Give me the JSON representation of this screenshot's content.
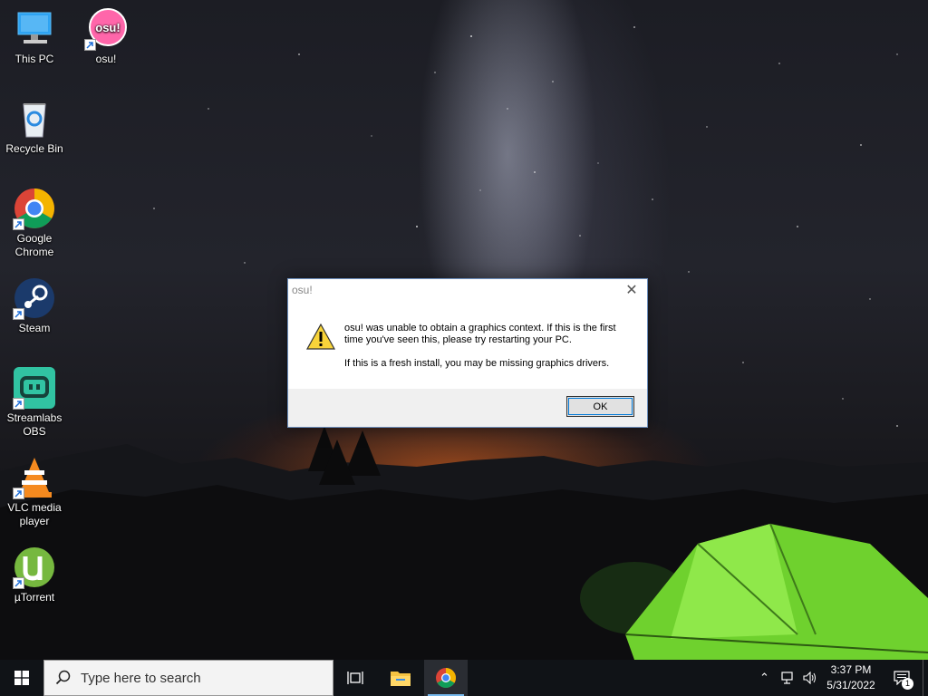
{
  "desktop": {
    "icons": [
      {
        "label": "This PC",
        "icon": "computer-icon"
      },
      {
        "label": "osu!",
        "icon": "osu-icon"
      },
      {
        "label": "Recycle Bin",
        "icon": "recycle-bin-icon"
      },
      {
        "label": "Google Chrome",
        "icon": "chrome-icon"
      },
      {
        "label": "Steam",
        "icon": "steam-icon"
      },
      {
        "label": "Streamlabs OBS",
        "icon": "streamlabs-icon"
      },
      {
        "label": "VLC media player",
        "icon": "vlc-icon"
      },
      {
        "label": "µTorrent",
        "icon": "utorrent-icon"
      }
    ]
  },
  "dialog": {
    "title": "osu!",
    "message_line1": "osu! was unable to obtain a graphics context. If this is the first time you've seen this, please try restarting your PC.",
    "message_line2": "If this is a fresh install, you may be missing graphics drivers.",
    "ok_label": "OK",
    "icon": "warning-icon"
  },
  "taskbar": {
    "search_placeholder": "Type here to search",
    "time": "3:37 PM",
    "date": "5/31/2022",
    "notification_count": "1",
    "accent": "#76b9ed"
  },
  "colors": {
    "osu_pink": "#ff66aa",
    "streamlabs_teal": "#31c3a2",
    "utorrent_green": "#76b83f"
  }
}
